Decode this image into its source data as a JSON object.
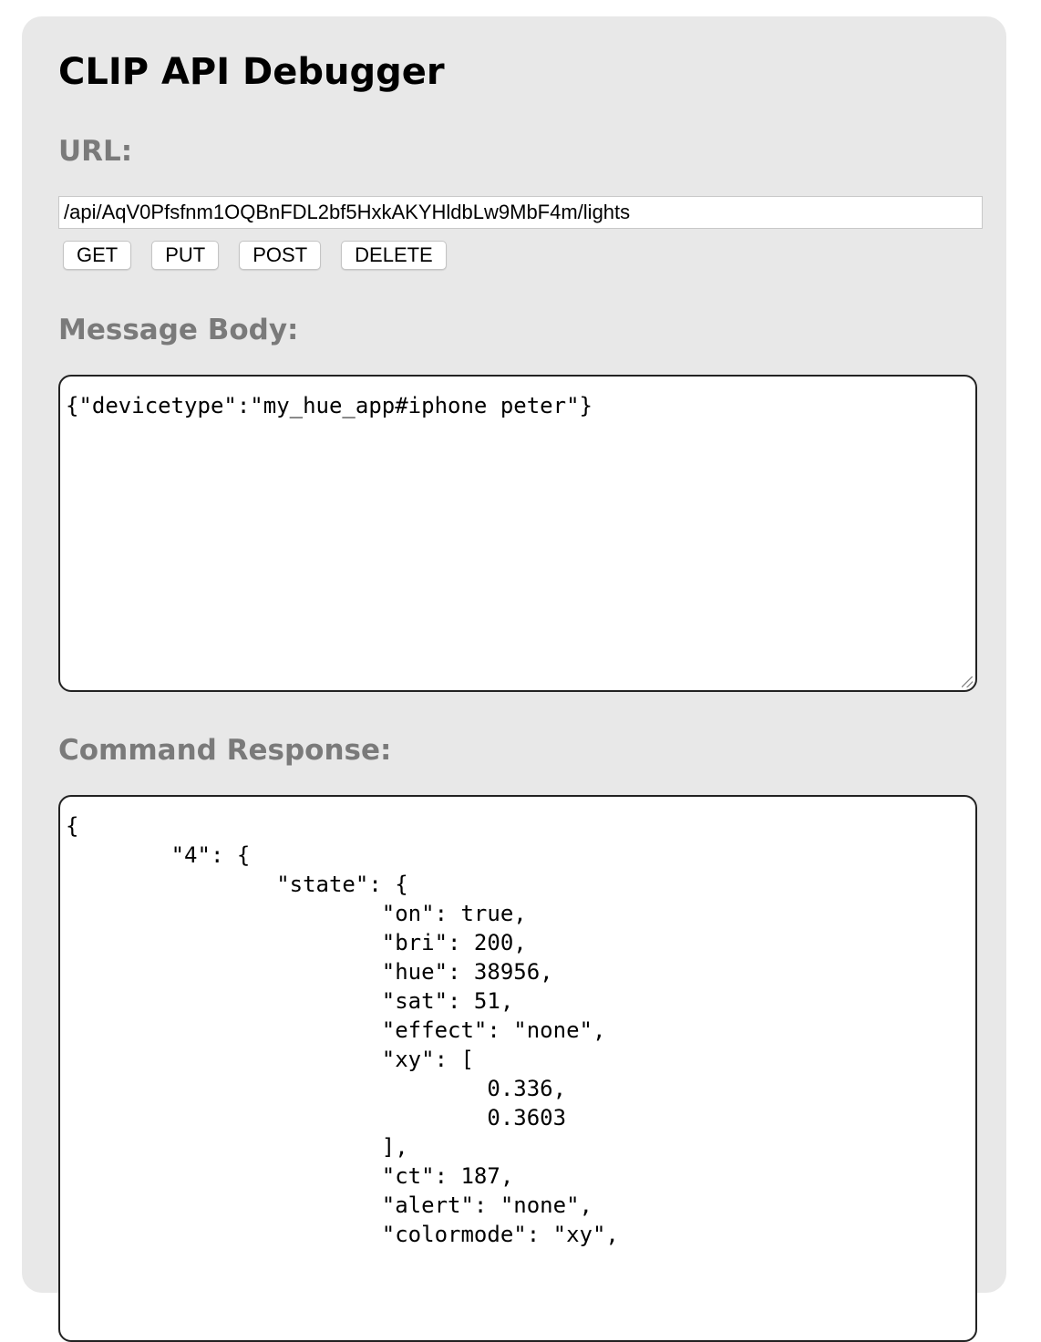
{
  "title": "CLIP API Debugger",
  "url_label": "URL:",
  "url_value": "/api/AqV0Pfsfnm1OQBnFDL2bf5HxkAKYHldbLw9MbF4m/lights",
  "buttons": {
    "get": "GET",
    "put": "PUT",
    "post": "POST",
    "delete": "DELETE"
  },
  "body_label": "Message Body:",
  "body_value": "{\"devicetype\":\"my_hue_app#iphone peter\"}",
  "response_label": "Command Response:",
  "response_value": "{\n\t\"4\": {\n\t\t\"state\": {\n\t\t\t\"on\": true,\n\t\t\t\"bri\": 200,\n\t\t\t\"hue\": 38956,\n\t\t\t\"sat\": 51,\n\t\t\t\"effect\": \"none\",\n\t\t\t\"xy\": [\n\t\t\t\t0.336,\n\t\t\t\t0.3603\n\t\t\t],\n\t\t\t\"ct\": 187,\n\t\t\t\"alert\": \"none\",\n\t\t\t\"colormode\": \"xy\","
}
